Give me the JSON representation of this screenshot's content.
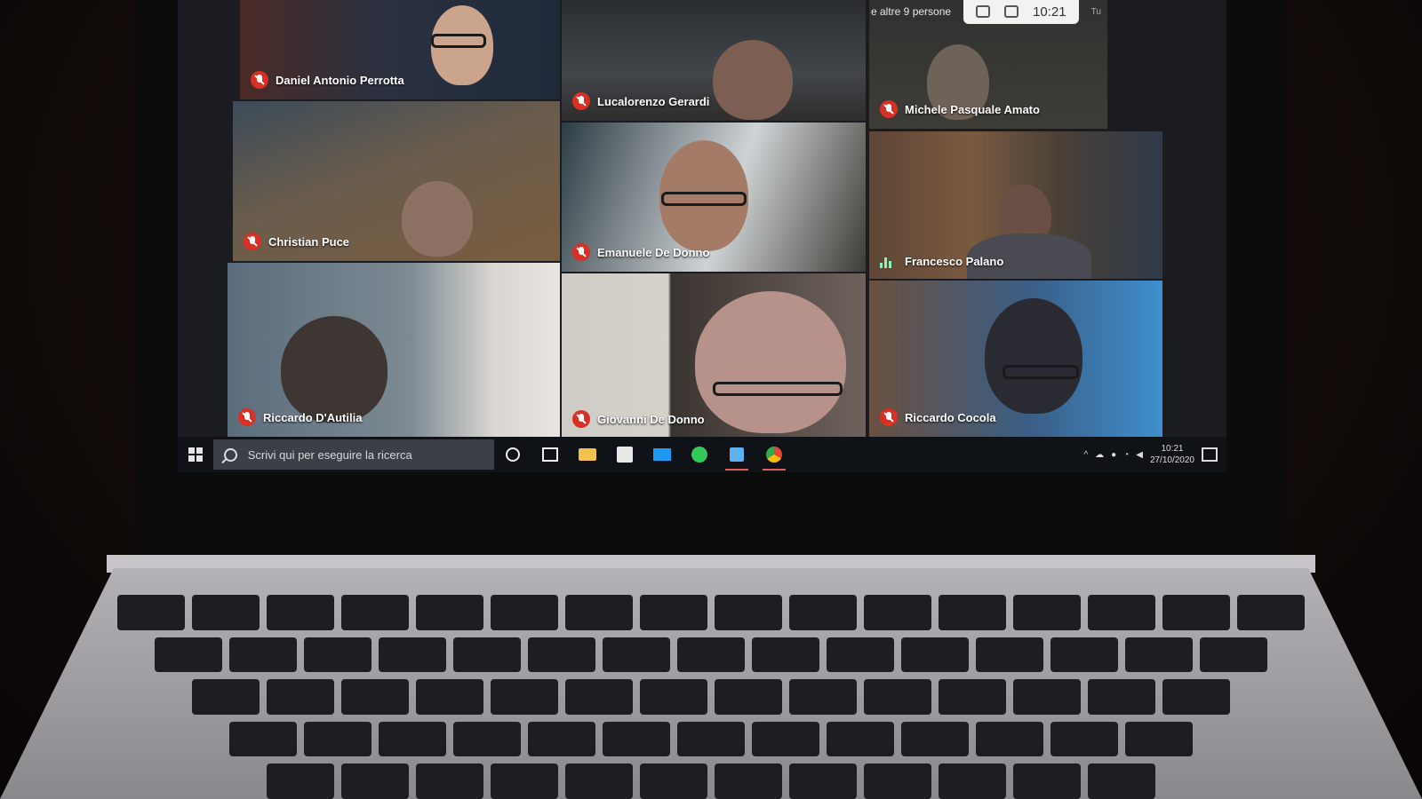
{
  "call": {
    "others_label": "e altre 9 persone",
    "time": "10:21",
    "you_label": "Tu"
  },
  "participants": [
    {
      "name": "Daniel Antonio Perrotta",
      "status": "muted"
    },
    {
      "name": "Lucalorenzo Gerardi",
      "status": "muted"
    },
    {
      "name": "Michele Pasquale Amato",
      "status": "muted"
    },
    {
      "name": "Christian Puce",
      "status": "muted"
    },
    {
      "name": "Emanuele De Donno",
      "status": "muted"
    },
    {
      "name": "Francesco Palano",
      "status": "speaking"
    },
    {
      "name": "Riccardo D'Autilia",
      "status": "muted"
    },
    {
      "name": "Giovanni De Donno",
      "status": "muted"
    },
    {
      "name": "Riccardo Cocola",
      "status": "muted"
    }
  ],
  "taskbar": {
    "search_placeholder": "Scrivi qui per eseguire la ricerca",
    "apps": [
      "cortana-icon",
      "task-view-icon",
      "file-explorer-icon",
      "store-icon",
      "mail-icon",
      "whatsapp-icon",
      "notes-icon",
      "chrome-icon"
    ],
    "clock_time": "10:21",
    "clock_date": "27/10/2020"
  },
  "colors": {
    "muted": "#d93025",
    "speaking": "#8ef1b6"
  }
}
